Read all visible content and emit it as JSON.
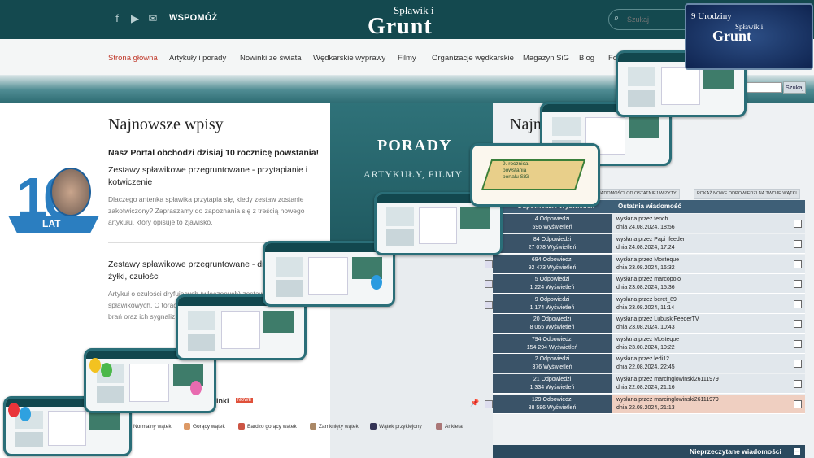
{
  "header": {
    "support_label": "WSPOMÓŻ",
    "logo_top": "Spławik i",
    "logo_main": "Grunt",
    "search_placeholder": "Szukaj"
  },
  "nav": {
    "items": [
      "Strona główna",
      "Artykuły i porady",
      "Nowinki ze świata",
      "Wędkarskie wyprawy",
      "Filmy",
      "Organizacje wędkarskie",
      "Magazyn SiG",
      "Blog",
      "Fo"
    ]
  },
  "left": {
    "heading": "Najnowsze wpisy",
    "anniversary": "Nasz Portal obchodzi dzisiaj 10 rocznicę powstania!",
    "badge_number": "10",
    "badge_label": "LAT",
    "articles": [
      {
        "title_l1": "Zestawy spławikowe przegruntowane - przytapianie i",
        "title_l2": "kotwiczenie",
        "excerpt_l1": "Dlaczego antenka spławika przytapia się, kiedy zestaw zostanie",
        "excerpt_l2": "zakotwiczony? Zapraszamy do zapoznania się z treścią nowego",
        "excerpt_l3": "artykułu, który opisuje to zjawisko."
      },
      {
        "title_l1": "Zestawy spławikowe przegruntowane - dryfowa",
        "title_l2": "żyłki, czułości",
        "excerpt_l1": "Artykuł o czułości dryfujących (wleczonych) zestaw",
        "excerpt_l2": "spławikowych. O torach",
        "excerpt_l3": "brań oraz ich sygnaliz"
      }
    ]
  },
  "middle": {
    "title": "PORADY",
    "subtitle": "ARTYKUŁY, FILMY"
  },
  "right": {
    "heading": "Najn",
    "search_btn": "Szukaj",
    "btn_recent": "WIADOMOŚCI OD OSTATNIEJ WIZYTY",
    "btn_mine": "POKAŻ NOWE ODPOWIEDZI NA TWOJE WĄTKI",
    "col_replies": "Odpowiedzi / Wyświetleń",
    "col_last": "Ostatnia wiadomość",
    "rows": [
      {
        "replies": "4 Odpowiedzi",
        "views": "596 Wyświetleń",
        "by": "wysłana przez tench",
        "date": "dnia 24.08.2024, 18:56"
      },
      {
        "replies": "84 Odpowiedzi",
        "views": "27 078 Wyświetleń",
        "by": "wysłana przez Papi_feeder",
        "date": "dnia 24.08.2024, 17:24"
      },
      {
        "replies": "694 Odpowiedzi",
        "views": "92 473 Wyświetleń",
        "by": "wysłana przez Mosteque",
        "date": "dnia 23.08.2024, 16:32"
      },
      {
        "replies": "5 Odpowiedzi",
        "views": "1 224 Wyświetleń",
        "by": "wysłana przez marcopolo",
        "date": "dnia 23.08.2024, 15:36"
      },
      {
        "replies": "9 Odpowiedzi",
        "views": "1 174 Wyświetleń",
        "by": "wysłana przez beret_89",
        "date": "dnia 23.08.2024, 11:14"
      },
      {
        "replies": "20 Odpowiedzi",
        "views": "8 065 Wyświetleń",
        "by": "wysłana przez LubuskiFeederTV",
        "date": "dnia 23.08.2024, 10:43"
      },
      {
        "replies": "794 Odpowiedzi",
        "views": "154 294 Wyświetleń",
        "by": "wysłana przez Mosteque",
        "date": "dnia 23.08.2024, 10:22"
      },
      {
        "replies": "2 Odpowiedzi",
        "views": "376 Wyświetleń",
        "by": "wysłana przez ledi12",
        "date": "dnia 22.08.2024, 22:45"
      },
      {
        "replies": "21 Odpowiedzi",
        "views": "1 334 Wyświetleń",
        "by": "wysłana przez marcinglowinski26111979",
        "date": "dnia 22.08.2024, 21:16"
      },
      {
        "replies": "129 Odpowiedzi",
        "views": "88 586 Wyświetleń",
        "by": "wysłana przez marcinglowinski26111979",
        "date": "dnia 22.08.2024, 21:13"
      }
    ],
    "partial_topics": [
      "et",
      "et",
      "e linki",
      "et"
    ],
    "new_badge": "NOWE",
    "legend": [
      "Normalny wątek",
      "Gorący wątek",
      "Bardzo gorący wątek",
      "Zamknięty wątek",
      "Wątek przyklejony",
      "Ankieta"
    ],
    "unread": "Nieprzeczytane wiadomości"
  },
  "promo": {
    "badge_line1": "9 Urodziny",
    "badge_line2": "Spławik i",
    "badge_line3": "Grunt",
    "cake_text_l1": "9. rocznica",
    "cake_text_l2": "powstania",
    "cake_text_l3": "portalu SiG"
  },
  "colors": {
    "header_bg": "#14494f",
    "nav_active": "#c0392b",
    "table_head": "#3e5f77",
    "highlight_row": "#efcfc1",
    "accent_blue": "#2b7ec0"
  }
}
